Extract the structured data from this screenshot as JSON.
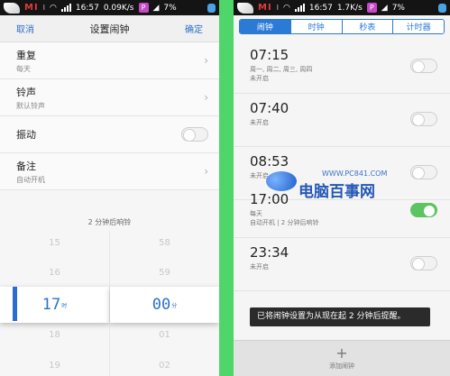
{
  "status_bar": {
    "carrier": "MI",
    "sim": "Ⅰ",
    "time": "16:57",
    "speed_left": "0.09K/s",
    "speed_right": "1.7K/s",
    "battery_left": "7%",
    "battery_right": "7%"
  },
  "left": {
    "header": {
      "cancel": "取消",
      "title": "设置闹钟",
      "confirm": "确定"
    },
    "settings": [
      {
        "label": "重复",
        "sub": "每天",
        "control": "chevron"
      },
      {
        "label": "铃声",
        "sub": "默认铃声",
        "control": "chevron"
      },
      {
        "label": "振动",
        "sub": "",
        "control": "toggle-off"
      },
      {
        "label": "备注",
        "sub": "自动开机",
        "control": "chevron"
      }
    ],
    "snooze_note": "2 分钟后响铃",
    "picker": {
      "hour": {
        "above": [
          "15",
          "16"
        ],
        "selected": "17",
        "unit": "时",
        "below": [
          "18",
          "19"
        ]
      },
      "minute": {
        "above": [
          "58",
          "59"
        ],
        "selected": "00",
        "unit": "分",
        "below": [
          "01",
          "02"
        ]
      }
    }
  },
  "right": {
    "tabs": [
      {
        "label": "闹钟",
        "active": true
      },
      {
        "label": "时钟",
        "active": false
      },
      {
        "label": "秒表",
        "active": false
      },
      {
        "label": "计时器",
        "active": false
      }
    ],
    "alarms": [
      {
        "time": "07:15",
        "line1": "周一, 周二, 周三, 周四",
        "line2": "未开启",
        "on": false
      },
      {
        "time": "07:40",
        "line1": "未开启",
        "line2": "",
        "on": false
      },
      {
        "time": "08:53",
        "line1": "未开启",
        "line2": "",
        "on": false
      },
      {
        "time": "17:00",
        "line1": "每天",
        "line2": "自动开机 | 2 分钟后响铃",
        "on": true
      },
      {
        "time": "23:34",
        "line1": "未开启",
        "line2": "",
        "on": false
      }
    ],
    "watermark": {
      "url": "WWW.PC841.COM",
      "title": "电脑百事网"
    },
    "toast": "已将闹钟设置为从现在起 2 分钟后提醒。",
    "add_alarm": {
      "icon": "+",
      "label": "添加闹钟"
    }
  },
  "colors": {
    "accent": "#2a7ad6",
    "toggle_on": "#5cc460",
    "divider_bg": "#4fd66a"
  }
}
